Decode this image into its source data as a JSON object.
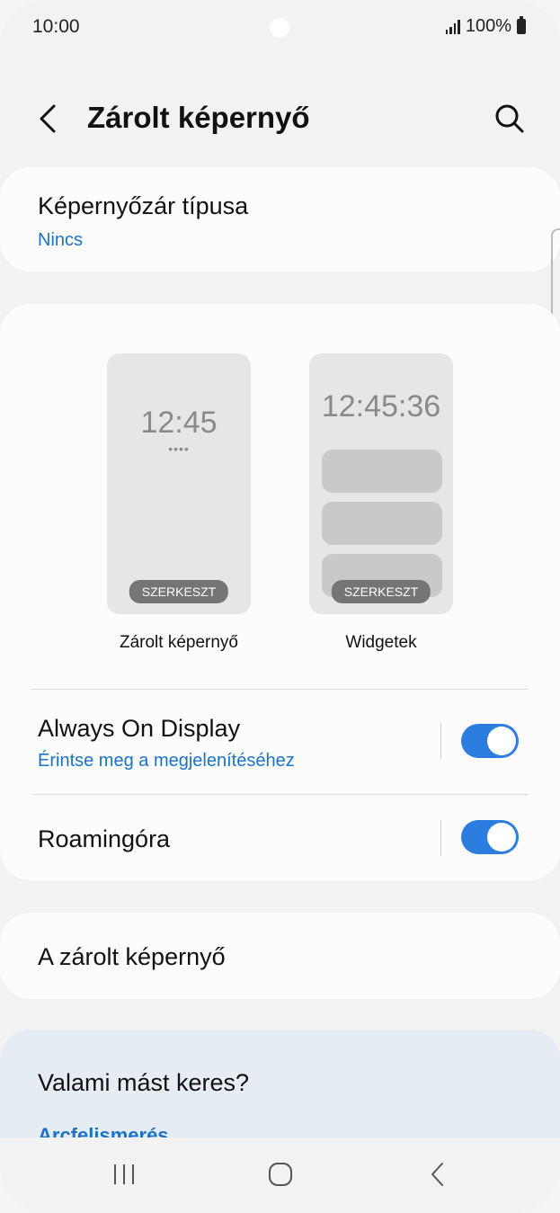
{
  "status_bar": {
    "time": "10:00",
    "battery": "100%"
  },
  "header": {
    "title": "Zárolt képernyő"
  },
  "lock_type": {
    "label": "Képernyőzár típusa",
    "value": "Nincs"
  },
  "previews": {
    "lock_screen": {
      "clock": "12:45",
      "dots": "••••",
      "edit_label": "SZERKESZT",
      "caption": "Zárolt képernyő"
    },
    "widgets": {
      "clock": "12:45:36",
      "edit_label": "SZERKESZT",
      "caption": "Widgetek"
    }
  },
  "settings": {
    "aod": {
      "label": "Always On Display",
      "sub": "Érintse meg a megjelenítéséhez",
      "enabled": true
    },
    "roaming": {
      "label": "Roamingóra",
      "enabled": true
    }
  },
  "about": {
    "label": "A zárolt képernyő"
  },
  "suggest": {
    "question": "Valami mást keres?",
    "link": "Arcfelismerés"
  },
  "colors": {
    "accent": "#2b7de0",
    "link": "#1a73c7",
    "background": "#f2f2f2"
  }
}
